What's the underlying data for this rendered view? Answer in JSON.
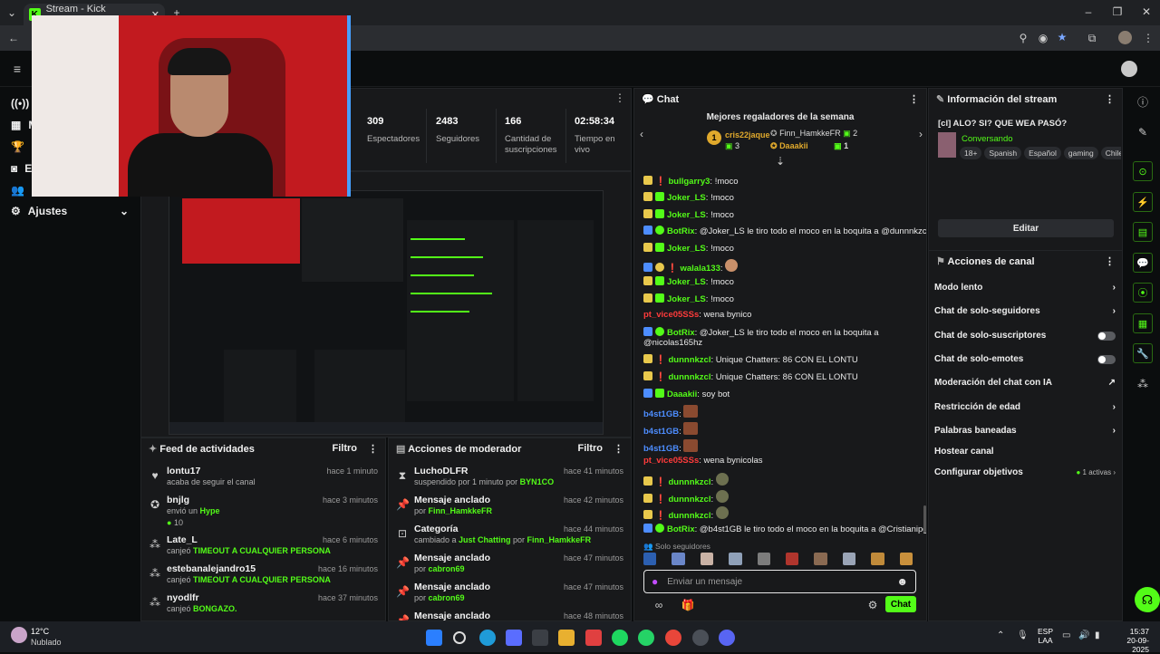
{
  "browser": {
    "tab_title": "Stream - Kick Dashboard"
  },
  "sidebar": {
    "items": [
      {
        "label": "S"
      },
      {
        "label": "M"
      },
      {
        "label": "L"
      },
      {
        "label": "E"
      },
      {
        "label": "C"
      },
      {
        "label": "Ajustes"
      }
    ]
  },
  "stats": {
    "items": [
      {
        "value": "309",
        "label": "Espectadores"
      },
      {
        "value": "2483",
        "label": "Seguidores"
      },
      {
        "value": "166",
        "label": "Cantidad de suscripciones"
      },
      {
        "value": "02:58:34",
        "label": "Tiempo en vivo"
      }
    ]
  },
  "feed": {
    "title": "Feed de actividades",
    "filter": "Filtro",
    "rows": [
      {
        "user": "lontu17",
        "action": "acaba de seguir el canal",
        "highlight": "",
        "time": "hace 1 minuto"
      },
      {
        "user": "bnjlg",
        "action": "envió un ",
        "highlight": "Hype",
        "extra": "10",
        "time": "hace 3 minutos"
      },
      {
        "user": "Late_L",
        "action": "canjeó ",
        "highlight": "TIMEOUT A CUALQUIER PERSONA",
        "time": "hace 6 minutos"
      },
      {
        "user": "estebanalejandro15",
        "action": "canjeó ",
        "highlight": "TIMEOUT A CUALQUIER PERSONA",
        "time": "hace 16 minutos"
      },
      {
        "user": "nyodlfr",
        "action": "canjeó ",
        "highlight": "BONGAZO.",
        "time": "hace 37 minutos"
      }
    ]
  },
  "mod": {
    "title": "Acciones de moderador",
    "filter": "Filtro",
    "rows": [
      {
        "title": "LuchoDLFR",
        "detail": "suspendido por 1 minuto por ",
        "who": "BYN1CO",
        "time": "hace 41 minutos"
      },
      {
        "title": "Mensaje anclado",
        "detail": "por ",
        "who": "Finn_HamkkeFR",
        "time": "hace 42 minutos"
      },
      {
        "title": "Categoría",
        "detail": "cambiado a ",
        "who": "Just Chatting",
        "detail2": " por ",
        "who2": "Finn_HamkkeFR",
        "time": "hace 44 minutos"
      },
      {
        "title": "Mensaje anclado",
        "detail": "por ",
        "who": "cabron69",
        "time": "hace 47 minutos"
      },
      {
        "title": "Mensaje anclado",
        "detail": "por ",
        "who": "cabron69",
        "time": "hace 47 minutos"
      },
      {
        "title": "Mensaje anclado",
        "detail": "",
        "who": "",
        "time": "hace 48 minutos"
      }
    ]
  },
  "chat": {
    "title": "Chat",
    "top_title": "Mejores regaladores de la semana",
    "gifters": [
      {
        "rank": "1",
        "name": "cris22jaque",
        "count": "3"
      },
      {
        "rank": "2",
        "name": "Finn_HamkkeFR",
        "count": "2"
      },
      {
        "rank": "3",
        "name": "Daaakii",
        "count": "1"
      }
    ],
    "messages": [
      {
        "user": "bullgarry3",
        "color": "g",
        "text": "!moco"
      },
      {
        "user": "Joker_LS",
        "color": "g",
        "text": "!moco"
      },
      {
        "user": "Joker_LS",
        "color": "g",
        "text": "!moco"
      },
      {
        "user": "BotRix",
        "color": "g",
        "text": "@Joker_LS le tiro todo el moco en la boquita a @dunnnkzcl"
      },
      {
        "user": "Joker_LS",
        "color": "g",
        "text": "!moco"
      },
      {
        "user": "walala133",
        "color": "g",
        "text": ""
      },
      {
        "user": "Joker_LS",
        "color": "g",
        "text": "!moco"
      },
      {
        "user": "Joker_LS",
        "color": "g",
        "text": "!moco"
      },
      {
        "user": "pt_vice05SSs",
        "color": "r",
        "text": "wena bynico"
      },
      {
        "user": "BotRix",
        "color": "g",
        "text": "@Joker_LS le tiro todo el moco en la boquita a @nicolas165hz"
      },
      {
        "user": "dunnnkzcl",
        "color": "g",
        "text": "Unique Chatters: 86 CON EL LONTU"
      },
      {
        "user": "dunnnkzcl",
        "color": "g",
        "text": "Unique Chatters: 86 CON EL LONTU"
      },
      {
        "user": "Daaakii",
        "color": "g",
        "text": "soy bot"
      },
      {
        "user": "b4st1GB",
        "color": "b",
        "text": ""
      },
      {
        "user": "b4st1GB",
        "color": "b",
        "text": ""
      },
      {
        "user": "b4st1GB",
        "color": "b",
        "text": ""
      },
      {
        "user": "pt_vice05SSs",
        "color": "r",
        "text": "wena bynicolas"
      },
      {
        "user": "dunnnkzcl",
        "color": "g",
        "text": ""
      },
      {
        "user": "dunnnkzcl",
        "color": "g",
        "text": ""
      },
      {
        "user": "dunnnkzcl",
        "color": "g",
        "text": ""
      },
      {
        "user": "BotRix",
        "color": "g",
        "text": "@b4st1GB le tiro todo el moco en la boquita a @Cristianipg"
      }
    ],
    "followers_only": "Solo seguidores",
    "input_placeholder": "Enviar un mensaje",
    "send_label": "Chat"
  },
  "info": {
    "title": "Información del stream",
    "stream_title": "[cl] ALO? SI? QUE WEA PASÓ?",
    "category": "Conversando",
    "tags": [
      "18+",
      "Spanish",
      "Español",
      "gaming",
      "Chile"
    ],
    "edit_label": "Editar",
    "actions_title": "Acciones de canal",
    "actions": [
      {
        "label": "Modo lento",
        "type": "arrow"
      },
      {
        "label": "Chat de solo-seguidores",
        "type": "arrow"
      },
      {
        "label": "Chat de solo-suscriptores",
        "type": "toggle"
      },
      {
        "label": "Chat de solo-emotes",
        "type": "toggle"
      },
      {
        "label": "Moderación del chat con IA",
        "type": "external"
      },
      {
        "label": "Restricción de edad",
        "type": "arrow"
      },
      {
        "label": "Palabras baneadas",
        "type": "arrow"
      },
      {
        "label": "Hostear canal",
        "type": "none"
      },
      {
        "label": "Configurar objetivos",
        "type": "arrow",
        "badge": "1 activas"
      }
    ]
  },
  "taskbar": {
    "weather_temp": "12°C",
    "weather_desc": "Nublado",
    "lang_top": "ESP",
    "lang_bottom": "LAA",
    "time": "15:37",
    "date": "20-09-2025"
  }
}
